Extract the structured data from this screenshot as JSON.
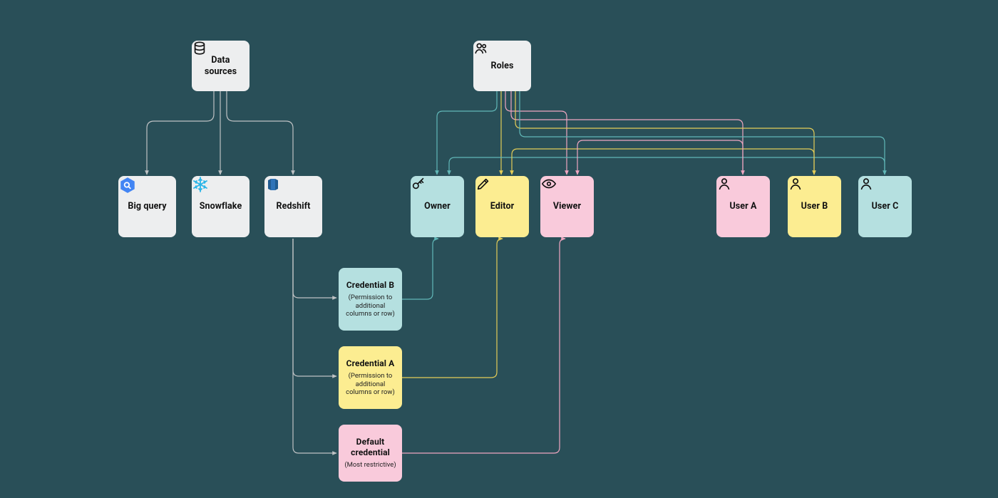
{
  "colors": {
    "teal": "#61b8b8",
    "yellow": "#e4cd57",
    "pink": "#f0a6c1",
    "gray": "#bfc2c4"
  },
  "nodes": {
    "data_sources": {
      "label": "Data sources"
    },
    "roles": {
      "label": "Roles"
    },
    "bigquery": {
      "label": "Big query"
    },
    "snowflake": {
      "label": "Snowflake"
    },
    "redshift": {
      "label": "Redshift"
    },
    "owner": {
      "label": "Owner"
    },
    "editor": {
      "label": "Editor"
    },
    "viewer": {
      "label": "Viewer"
    },
    "user_a": {
      "label": "User A"
    },
    "user_b": {
      "label": "User B"
    },
    "user_c": {
      "label": "User C"
    },
    "cred_b": {
      "title": "Credential B",
      "sub": "(Permission to additional columns or row)"
    },
    "cred_a": {
      "title": "Credential A",
      "sub": "(Permission to additional columns or row)"
    },
    "cred_default": {
      "title": "Default credential",
      "sub": "(Most restrictive)"
    }
  },
  "edges_note": "Edges: data_sources → bigquery/snowflake/redshift (gray). roles → owner/editor/viewer and roles → user_a/user_b/user_c (teal/yellow/pink). redshift → cred_b/cred_a/cred_default (gray). cred_b → owner (teal), cred_a → editor (yellow), cred_default → viewer (pink). user_a → viewer (pink), user_b → editor (yellow), user_c → owner (teal)."
}
